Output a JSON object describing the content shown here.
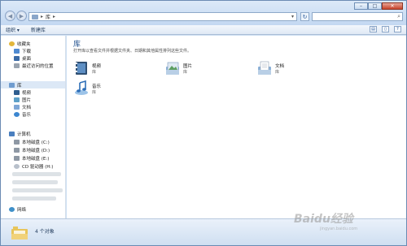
{
  "address": {
    "path": "库"
  },
  "toolbar": {
    "organize": "组织 ▾",
    "new_library": "新建库"
  },
  "nav": {
    "favorites": "收藏夹",
    "downloads": "下载",
    "desktop": "桌面",
    "recent": "最近访问的位置",
    "libraries": "库",
    "videos": "视频",
    "pictures": "图片",
    "documents": "文档",
    "music": "音乐",
    "computer": "计算机",
    "drive_c": "本地磁盘 (C:)",
    "drive_d": "本地磁盘 (D:)",
    "drive_e": "本地磁盘 (E:)",
    "drive_cd": "CD 驱动器 (H:)",
    "network": "网络"
  },
  "content": {
    "title": "库",
    "subtitle": "打开库以查看文件并根据文件夹、日期和其他属性排列这些文件。",
    "items": [
      {
        "name": "视频",
        "type": "库"
      },
      {
        "name": "图片",
        "type": "库"
      },
      {
        "name": "文档",
        "type": "库"
      },
      {
        "name": "音乐",
        "type": "库"
      }
    ]
  },
  "details": {
    "count": "4 个对象"
  },
  "watermark": {
    "brand": "Baidu经验",
    "url": "jingyan.baidu.com"
  }
}
